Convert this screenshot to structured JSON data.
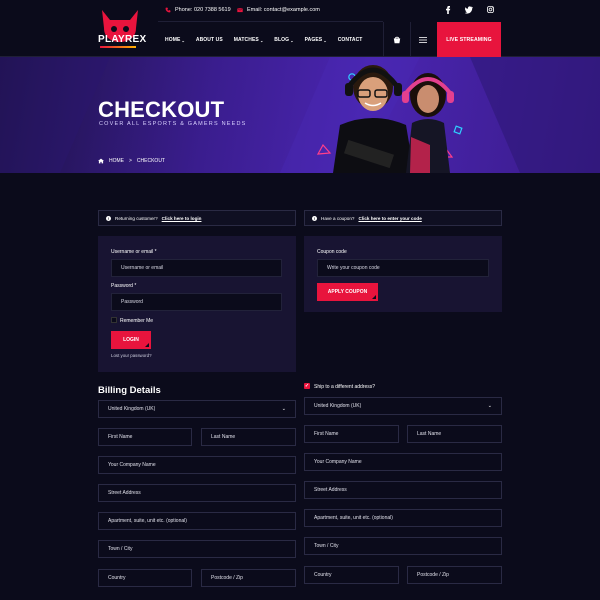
{
  "brand": {
    "name": "PLAYREX"
  },
  "topbar": {
    "phone": "Phone: 020 7388 5619",
    "email": "Email: contact@example.com",
    "social": [
      "f",
      "t",
      "ig"
    ]
  },
  "nav": {
    "items": [
      {
        "label": "HOME",
        "caret": true
      },
      {
        "label": "ABOUT US",
        "caret": false
      },
      {
        "label": "MATCHES",
        "caret": true
      },
      {
        "label": "BLOG",
        "caret": true
      },
      {
        "label": "PAGES",
        "caret": true
      },
      {
        "label": "CONTACT",
        "caret": false
      }
    ],
    "live_button": "LIVE STREAMING"
  },
  "hero": {
    "title": "CHECKOUT",
    "subtitle": "COVER ALL ESPORTS & GAMERS NEEDS",
    "breadcrumb": [
      "HOME",
      "CHECKOUT"
    ]
  },
  "notices": {
    "login": {
      "text": "Returning customer?",
      "link": "Click here to login"
    },
    "coupon": {
      "text": "Have a coupon?",
      "link": "Click here to enter your code"
    }
  },
  "login_form": {
    "username_label": "Username or email *",
    "username_placeholder": "Username or email",
    "password_label": "Password *",
    "password_placeholder": "Password",
    "remember": "Remember Me",
    "submit": "LOGIN",
    "lost": "Lost your password?"
  },
  "coupon_form": {
    "label": "Coupon code",
    "placeholder": "Write your coupon code",
    "submit": "APPLY COUPON"
  },
  "billing": {
    "title": "Billing Details",
    "country": "United Kingdom (UK)",
    "first_name": "First Name",
    "last_name": "Last Name",
    "company": "Your Company Name",
    "street": "Street Address",
    "apartment": "Apartment, suite, unit etc. (optional)",
    "town": "Town / City",
    "country_field": "Country",
    "postcode": "Postcode / Zip"
  },
  "shipping": {
    "checkbox_label": "Ship to a different address?",
    "country": "United Kingdom (UK)",
    "first_name": "First Name",
    "last_name": "Last Name",
    "company": "Your Company Name",
    "street": "Street Address",
    "apartment": "Apartment, suite, unit etc. (optional)",
    "town": "Town / City",
    "country_field": "Country",
    "postcode": "Postcode / Zip"
  },
  "colors": {
    "accent": "#e8143d",
    "background": "#0b0b1b",
    "panel": "#181432",
    "hero": "#3a1d8e"
  }
}
